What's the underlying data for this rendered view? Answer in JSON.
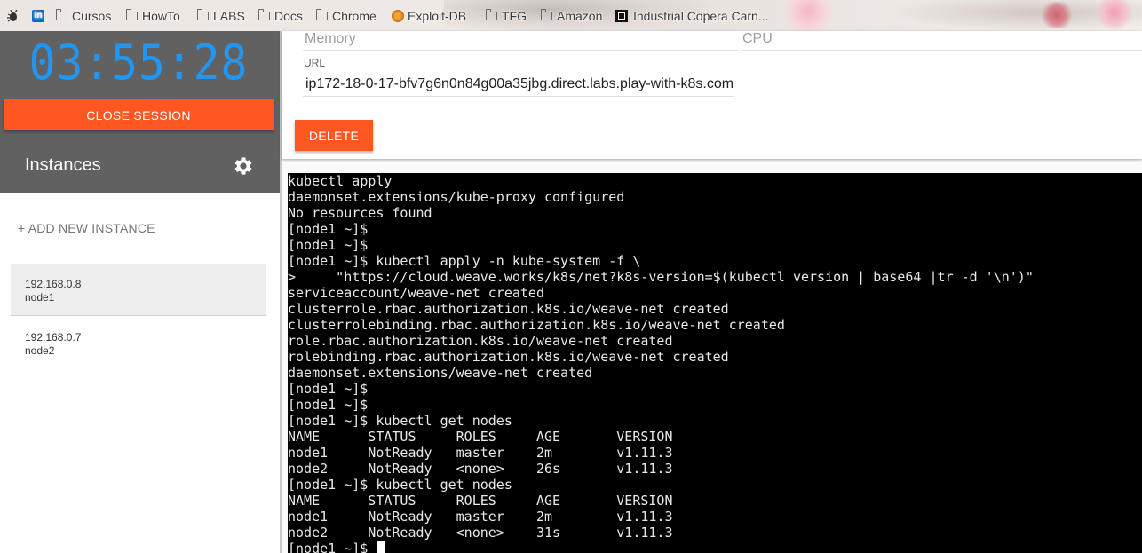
{
  "bookmarks": {
    "items": [
      {
        "label": "",
        "icon": "bug-icon"
      },
      {
        "label": "",
        "icon": "linkedin-icon"
      },
      {
        "label": "Cursos",
        "icon": "folder-icon"
      },
      {
        "label": "HowTo",
        "icon": "folder-icon"
      },
      {
        "label": "LABS",
        "icon": "folder-icon"
      },
      {
        "label": "Docs",
        "icon": "folder-icon"
      },
      {
        "label": "Chrome",
        "icon": "folder-icon"
      },
      {
        "label": "Exploit-DB",
        "icon": "exploit-db-icon"
      },
      {
        "label": "TFG",
        "icon": "folder-icon"
      },
      {
        "label": "Amazon",
        "icon": "folder-icon"
      },
      {
        "label": "Industrial Copera Carn...",
        "icon": "site-icon"
      }
    ],
    "linkedin_glyph": "in"
  },
  "sidebar": {
    "timer": "03:55:28",
    "close_session_label": "CLOSE SESSION",
    "instances_title": "Instances",
    "add_instance_label": "+ ADD NEW INSTANCE",
    "instances": [
      {
        "ip": "192.168.0.8",
        "hostname": "node1",
        "active": true
      },
      {
        "ip": "192.168.0.7",
        "hostname": "node2",
        "active": false
      }
    ]
  },
  "instance_panel": {
    "memory_label": "Memory",
    "cpu_label": "CPU",
    "url_label": "URL",
    "url_value": "ip172-18-0-17-bfv7g6n0n84g00a35jbg.direct.labs.play-with-k8s.com",
    "delete_label": "DELETE"
  },
  "terminal": {
    "lines": [
      "kubectl apply",
      "daemonset.extensions/kube-proxy configured",
      "No resources found",
      "[node1 ~]$",
      "[node1 ~]$",
      "[node1 ~]$ kubectl apply -n kube-system -f \\",
      ">     \"https://cloud.weave.works/k8s/net?k8s-version=$(kubectl version | base64 |tr -d '\\n')\"",
      "serviceaccount/weave-net created",
      "clusterrole.rbac.authorization.k8s.io/weave-net created",
      "clusterrolebinding.rbac.authorization.k8s.io/weave-net created",
      "role.rbac.authorization.k8s.io/weave-net created",
      "rolebinding.rbac.authorization.k8s.io/weave-net created",
      "daemonset.extensions/weave-net created",
      "[node1 ~]$",
      "[node1 ~]$",
      "[node1 ~]$ kubectl get nodes",
      "NAME      STATUS     ROLES     AGE       VERSION",
      "node1     NotReady   master    2m        v1.11.3",
      "node2     NotReady   <none>    26s       v1.11.3",
      "[node1 ~]$ kubectl get nodes",
      "NAME      STATUS     ROLES     AGE       VERSION",
      "node1     NotReady   master    2m        v1.11.3",
      "node2     NotReady   <none>    31s       v1.11.3"
    ],
    "prompt": "[node1 ~]$ "
  },
  "colors": {
    "accent": "#ff5722",
    "timer": "#2196f3",
    "sidebar_header": "#616161",
    "terminal_bg": "#000000",
    "terminal_fg": "#e8e8e8"
  }
}
